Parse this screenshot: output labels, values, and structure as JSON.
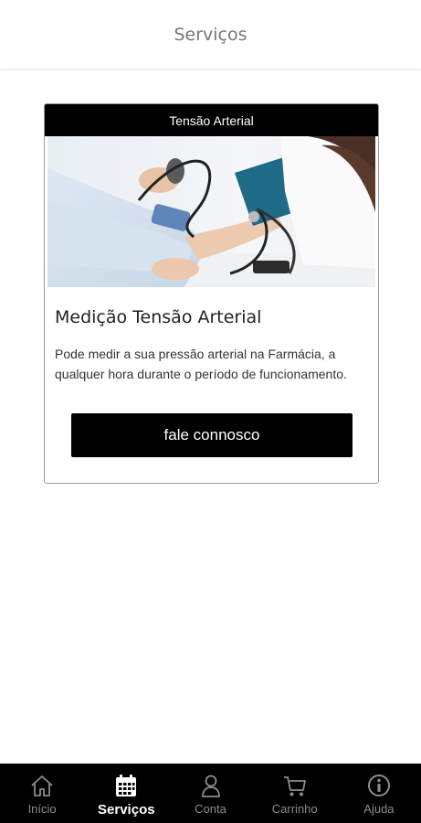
{
  "header": {
    "title": "Serviços"
  },
  "card": {
    "badge": "Tensão Arterial",
    "title": "Medição Tensão Arterial",
    "description": "Pode medir a sua pressão arterial na Farmácia, a qualquer hora durante o período de funcionamento.",
    "button_label": "fale connosco",
    "image_icon": "blood-pressure-photo"
  },
  "tabbar": {
    "active_color": "#ffffff",
    "inactive_color": "#8c8c8c",
    "items": [
      {
        "label": "Início",
        "icon": "home-icon",
        "active": false
      },
      {
        "label": "Serviços",
        "icon": "calendar-icon",
        "active": true
      },
      {
        "label": "Conta",
        "icon": "user-icon",
        "active": false
      },
      {
        "label": "Carrinho",
        "icon": "cart-icon",
        "active": false
      },
      {
        "label": "Ajuda",
        "icon": "info-icon",
        "active": false
      }
    ]
  }
}
